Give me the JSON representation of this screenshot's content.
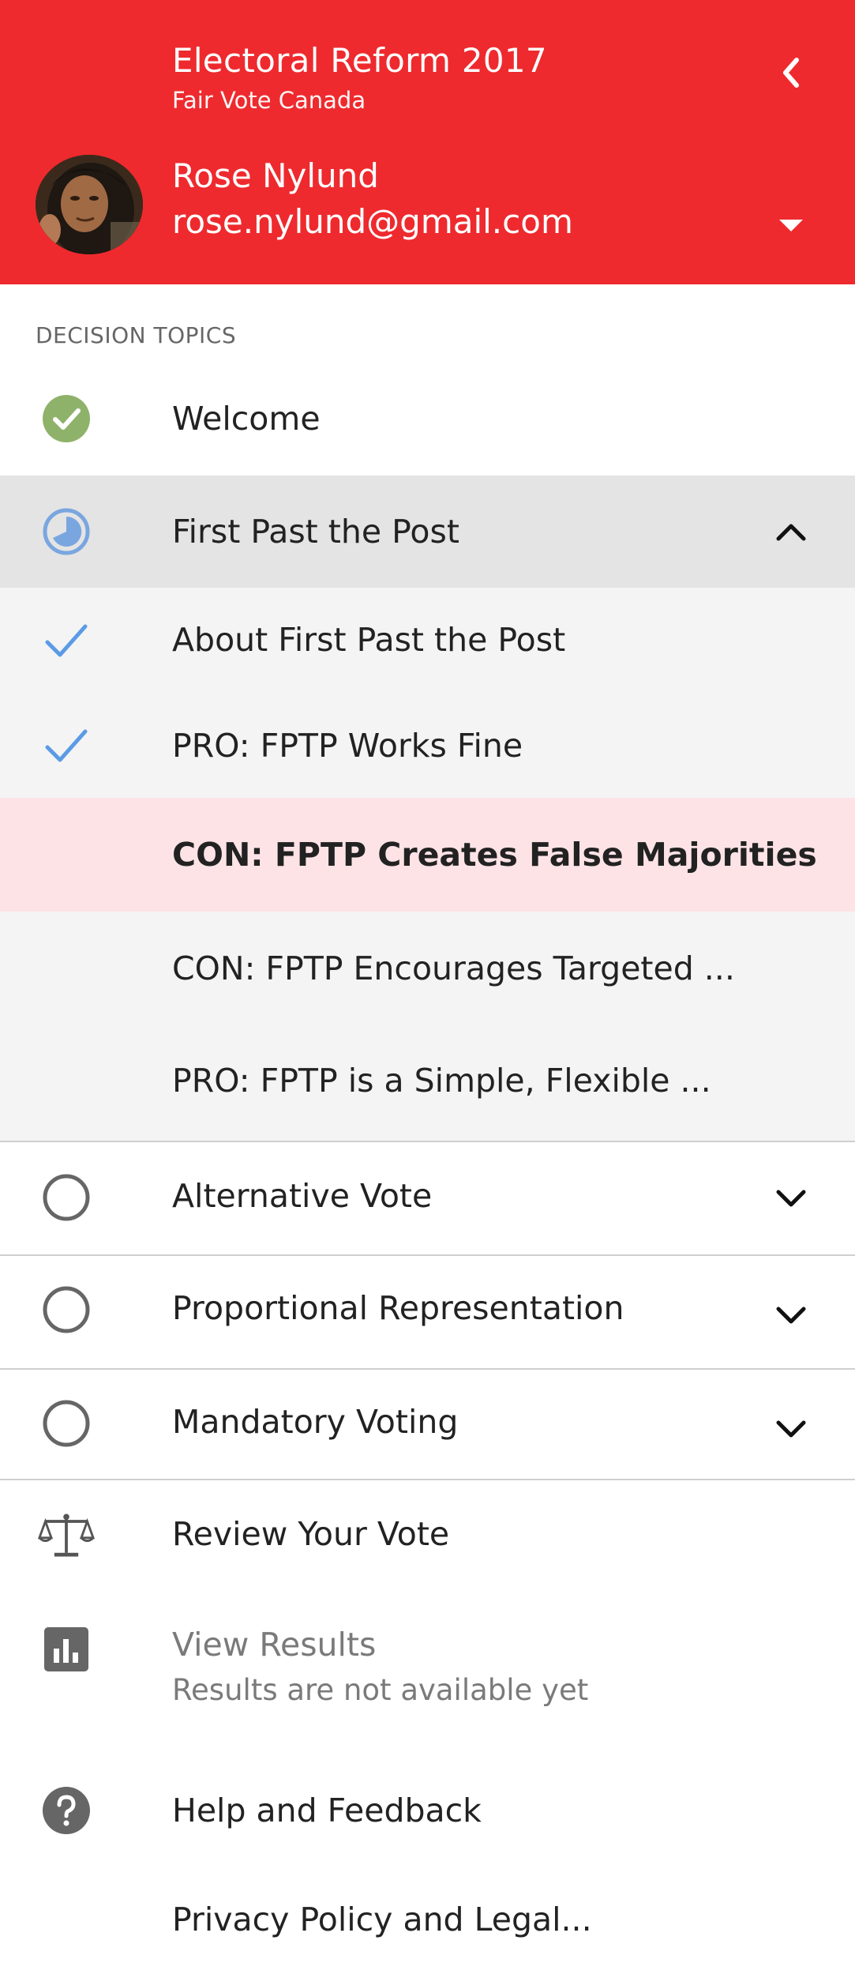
{
  "header": {
    "title": "Electoral Reform 2017",
    "subtitle": "Fair Vote Canada",
    "user_name": "Rose Nylund",
    "user_email": "rose.nylund@gmail.com",
    "back_icon": "chevron-left-icon",
    "account_toggle_icon": "caret-down-icon",
    "color": "#ee2a2e"
  },
  "section_label": "DECISION TOPICS",
  "topics": {
    "welcome": {
      "label": "Welcome",
      "status": "complete",
      "status_color": "#8fb26a"
    },
    "fptp": {
      "label": "First Past the Post",
      "status": "in-progress",
      "status_color": "#7aa6e0",
      "expanded": true,
      "items": [
        {
          "label": "About First Past the Post",
          "checked": true
        },
        {
          "label": "PRO: FPTP Works Fine",
          "checked": true
        },
        {
          "label": "CON: FPTP Creates False Majorities",
          "checked": false,
          "active": true
        },
        {
          "label": "CON: FPTP Encourages Targeted ...",
          "checked": false
        },
        {
          "label": "PRO: FPTP is a Simple, Flexible ...",
          "checked": false
        }
      ]
    },
    "alternative_vote": {
      "label": "Alternative Vote",
      "status": "not-started"
    },
    "proportional": {
      "label": "Proportional Representation",
      "status": "not-started"
    },
    "mandatory": {
      "label": "Mandatory Voting",
      "status": "not-started"
    }
  },
  "menu": {
    "review": {
      "label": "Review Your Vote",
      "icon": "scales-icon"
    },
    "results": {
      "label": "View Results",
      "sublabel": "Results are not available yet",
      "icon": "bar-chart-icon"
    },
    "help": {
      "label": "Help and Feedback",
      "icon": "help-circle-icon"
    },
    "privacy": {
      "label": "Privacy Policy and Legal..."
    }
  },
  "colors": {
    "check_blue": "#5b9be6",
    "active_row_bg": "#fde3e6",
    "selected_row_bg": "#e4e4e4",
    "sub_row_bg": "#f4f4f4"
  }
}
